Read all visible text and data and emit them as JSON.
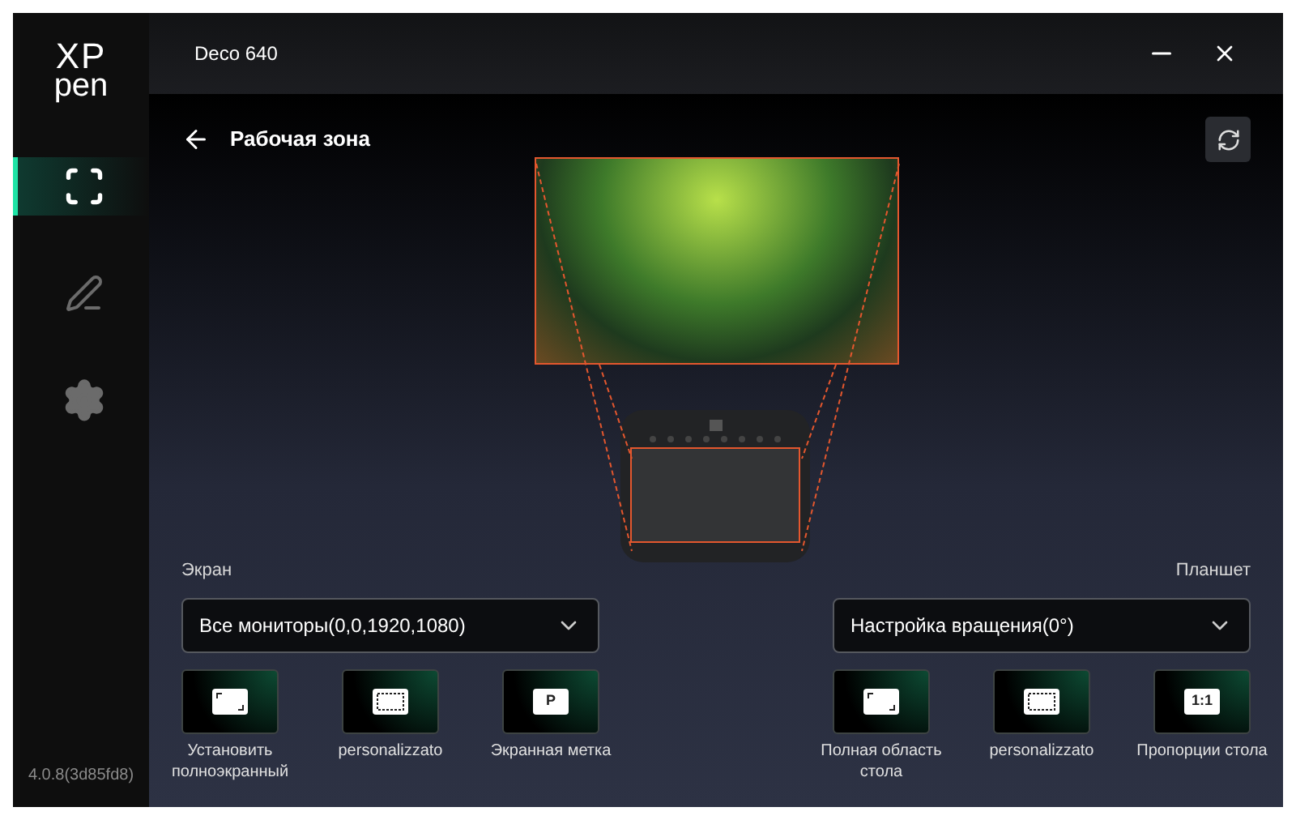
{
  "logo": {
    "line_1": "XP",
    "line_2": "pen"
  },
  "sidebar": {
    "items": [
      {
        "kind": "work-area",
        "selected": true
      },
      {
        "kind": "pen",
        "selected": false
      },
      {
        "kind": "settings",
        "selected": false
      }
    ],
    "version": "4.0.8(3d85fd8)"
  },
  "window": {
    "title": "Deco 640"
  },
  "page": {
    "title": "Рабочая зона"
  },
  "screen": {
    "label": "Экран",
    "dropdown": "Все мониторы(0,0,1920,1080)",
    "options": [
      {
        "kind": "fullscreen",
        "label": "Установить полноэкранный"
      },
      {
        "kind": "custom",
        "label": "personalizzato"
      },
      {
        "kind": "text",
        "icon_text": "P",
        "label": "Экранная метка"
      }
    ]
  },
  "tablet": {
    "label": "Планшет",
    "dropdown": "Настройка вращения(0°)",
    "options": [
      {
        "kind": "fullscreen",
        "label": "Полная область стола"
      },
      {
        "kind": "custom",
        "label": "personalizzato"
      },
      {
        "kind": "text",
        "icon_text": "1:1",
        "label": "Пропорции стола"
      }
    ]
  }
}
